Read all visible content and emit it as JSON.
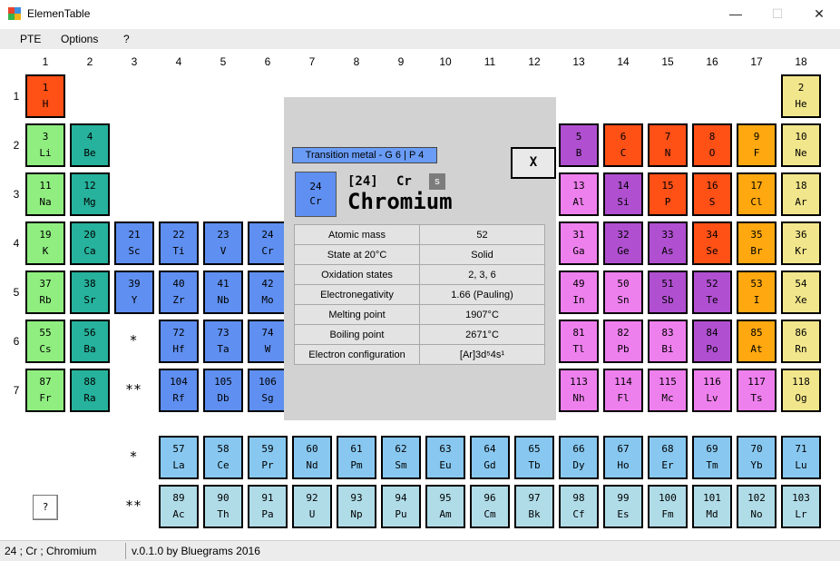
{
  "window": {
    "title": "ElemenTable",
    "minimize_icon": "minimize-icon",
    "maximize_icon": "maximize-icon",
    "close_icon": "close-icon"
  },
  "menu": [
    "PTE",
    "Options",
    "?"
  ],
  "groups": [
    "1",
    "2",
    "3",
    "4",
    "5",
    "6",
    "7",
    "8",
    "9",
    "10",
    "11",
    "12",
    "13",
    "14",
    "15",
    "16",
    "17",
    "18"
  ],
  "periods": [
    "1",
    "2",
    "3",
    "4",
    "5",
    "6",
    "7"
  ],
  "series_markers": {
    "lanthanide": "*",
    "actinide": "**"
  },
  "help_button": "?",
  "colors": {
    "alkali": "#90ee80",
    "alkaline_earth": "#26b29c",
    "transition": "#5f8ff0",
    "post_transition": "#ee80ee",
    "metalloid": "#b050d0",
    "nonmetal": "#ff5016",
    "halogen": "#ffa810",
    "noble_gas": "#f2e68c",
    "lanthanide": "#88c8f0",
    "actinide": "#b0dce8"
  },
  "elements": [
    {
      "n": "1",
      "s": "H",
      "t": "nonmetal"
    },
    {
      "n": "2",
      "s": "He",
      "t": "noble_gas"
    },
    {
      "n": "3",
      "s": "Li",
      "t": "alkali"
    },
    {
      "n": "4",
      "s": "Be",
      "t": "alkaline_earth"
    },
    {
      "n": "5",
      "s": "B",
      "t": "metalloid"
    },
    {
      "n": "6",
      "s": "C",
      "t": "nonmetal"
    },
    {
      "n": "7",
      "s": "N",
      "t": "nonmetal"
    },
    {
      "n": "8",
      "s": "O",
      "t": "nonmetal"
    },
    {
      "n": "9",
      "s": "F",
      "t": "halogen"
    },
    {
      "n": "10",
      "s": "Ne",
      "t": "noble_gas"
    },
    {
      "n": "11",
      "s": "Na",
      "t": "alkali"
    },
    {
      "n": "12",
      "s": "Mg",
      "t": "alkaline_earth"
    },
    {
      "n": "13",
      "s": "Al",
      "t": "post_transition"
    },
    {
      "n": "14",
      "s": "Si",
      "t": "metalloid"
    },
    {
      "n": "15",
      "s": "P",
      "t": "nonmetal"
    },
    {
      "n": "16",
      "s": "S",
      "t": "nonmetal"
    },
    {
      "n": "17",
      "s": "Cl",
      "t": "halogen"
    },
    {
      "n": "18",
      "s": "Ar",
      "t": "noble_gas"
    },
    {
      "n": "19",
      "s": "K",
      "t": "alkali"
    },
    {
      "n": "20",
      "s": "Ca",
      "t": "alkaline_earth"
    },
    {
      "n": "21",
      "s": "Sc",
      "t": "transition"
    },
    {
      "n": "22",
      "s": "Ti",
      "t": "transition"
    },
    {
      "n": "23",
      "s": "V",
      "t": "transition"
    },
    {
      "n": "24",
      "s": "Cr",
      "t": "transition"
    },
    {
      "n": "31",
      "s": "Ga",
      "t": "post_transition"
    },
    {
      "n": "32",
      "s": "Ge",
      "t": "metalloid"
    },
    {
      "n": "33",
      "s": "As",
      "t": "metalloid"
    },
    {
      "n": "34",
      "s": "Se",
      "t": "nonmetal"
    },
    {
      "n": "35",
      "s": "Br",
      "t": "halogen"
    },
    {
      "n": "36",
      "s": "Kr",
      "t": "noble_gas"
    },
    {
      "n": "37",
      "s": "Rb",
      "t": "alkali"
    },
    {
      "n": "38",
      "s": "Sr",
      "t": "alkaline_earth"
    },
    {
      "n": "39",
      "s": "Y",
      "t": "transition"
    },
    {
      "n": "40",
      "s": "Zr",
      "t": "transition"
    },
    {
      "n": "41",
      "s": "Nb",
      "t": "transition"
    },
    {
      "n": "42",
      "s": "Mo",
      "t": "transition"
    },
    {
      "n": "49",
      "s": "In",
      "t": "post_transition"
    },
    {
      "n": "50",
      "s": "Sn",
      "t": "post_transition"
    },
    {
      "n": "51",
      "s": "Sb",
      "t": "metalloid"
    },
    {
      "n": "52",
      "s": "Te",
      "t": "metalloid"
    },
    {
      "n": "53",
      "s": "I",
      "t": "halogen"
    },
    {
      "n": "54",
      "s": "Xe",
      "t": "noble_gas"
    },
    {
      "n": "55",
      "s": "Cs",
      "t": "alkali"
    },
    {
      "n": "56",
      "s": "Ba",
      "t": "alkaline_earth"
    },
    {
      "n": "72",
      "s": "Hf",
      "t": "transition"
    },
    {
      "n": "73",
      "s": "Ta",
      "t": "transition"
    },
    {
      "n": "74",
      "s": "W",
      "t": "transition"
    },
    {
      "n": "81",
      "s": "Tl",
      "t": "post_transition"
    },
    {
      "n": "82",
      "s": "Pb",
      "t": "post_transition"
    },
    {
      "n": "83",
      "s": "Bi",
      "t": "post_transition"
    },
    {
      "n": "84",
      "s": "Po",
      "t": "metalloid"
    },
    {
      "n": "85",
      "s": "At",
      "t": "halogen"
    },
    {
      "n": "86",
      "s": "Rn",
      "t": "noble_gas"
    },
    {
      "n": "87",
      "s": "Fr",
      "t": "alkali"
    },
    {
      "n": "88",
      "s": "Ra",
      "t": "alkaline_earth"
    },
    {
      "n": "104",
      "s": "Rf",
      "t": "transition"
    },
    {
      "n": "105",
      "s": "Db",
      "t": "transition"
    },
    {
      "n": "106",
      "s": "Sg",
      "t": "transition"
    },
    {
      "n": "113",
      "s": "Nh",
      "t": "post_transition"
    },
    {
      "n": "114",
      "s": "Fl",
      "t": "post_transition"
    },
    {
      "n": "115",
      "s": "Mc",
      "t": "post_transition"
    },
    {
      "n": "116",
      "s": "Lv",
      "t": "post_transition"
    },
    {
      "n": "117",
      "s": "Ts",
      "t": "post_transition"
    },
    {
      "n": "118",
      "s": "Og",
      "t": "noble_gas"
    },
    {
      "n": "57",
      "s": "La",
      "t": "lanthanide"
    },
    {
      "n": "58",
      "s": "Ce",
      "t": "lanthanide"
    },
    {
      "n": "59",
      "s": "Pr",
      "t": "lanthanide"
    },
    {
      "n": "60",
      "s": "Nd",
      "t": "lanthanide"
    },
    {
      "n": "61",
      "s": "Pm",
      "t": "lanthanide"
    },
    {
      "n": "62",
      "s": "Sm",
      "t": "lanthanide"
    },
    {
      "n": "63",
      "s": "Eu",
      "t": "lanthanide"
    },
    {
      "n": "64",
      "s": "Gd",
      "t": "lanthanide"
    },
    {
      "n": "65",
      "s": "Tb",
      "t": "lanthanide"
    },
    {
      "n": "66",
      "s": "Dy",
      "t": "lanthanide"
    },
    {
      "n": "67",
      "s": "Ho",
      "t": "lanthanide"
    },
    {
      "n": "68",
      "s": "Er",
      "t": "lanthanide"
    },
    {
      "n": "69",
      "s": "Tm",
      "t": "lanthanide"
    },
    {
      "n": "70",
      "s": "Yb",
      "t": "lanthanide"
    },
    {
      "n": "71",
      "s": "Lu",
      "t": "lanthanide"
    },
    {
      "n": "89",
      "s": "Ac",
      "t": "actinide"
    },
    {
      "n": "90",
      "s": "Th",
      "t": "actinide"
    },
    {
      "n": "91",
      "s": "Pa",
      "t": "actinide"
    },
    {
      "n": "92",
      "s": "U",
      "t": "actinide"
    },
    {
      "n": "93",
      "s": "Np",
      "t": "actinide"
    },
    {
      "n": "94",
      "s": "Pu",
      "t": "actinide"
    },
    {
      "n": "95",
      "s": "Am",
      "t": "actinide"
    },
    {
      "n": "96",
      "s": "Cm",
      "t": "actinide"
    },
    {
      "n": "97",
      "s": "Bk",
      "t": "actinide"
    },
    {
      "n": "98",
      "s": "Cf",
      "t": "actinide"
    },
    {
      "n": "99",
      "s": "Es",
      "t": "actinide"
    },
    {
      "n": "100",
      "s": "Fm",
      "t": "actinide"
    },
    {
      "n": "101",
      "s": "Md",
      "t": "actinide"
    },
    {
      "n": "102",
      "s": "No",
      "t": "actinide"
    },
    {
      "n": "103",
      "s": "Lr",
      "t": "actinide"
    }
  ],
  "detail": {
    "category": "Transition metal - G 6 | P 4",
    "close_label": "X",
    "tile_number": "24",
    "tile_symbol": "Cr",
    "number": "[24]",
    "symbol": "Cr",
    "block": "s",
    "name": "Chromium",
    "properties": [
      {
        "label": "Atomic mass",
        "value": "52"
      },
      {
        "label": "State at 20°C",
        "value": "Solid"
      },
      {
        "label": "Oxidation states",
        "value": "2, 3, 6"
      },
      {
        "label": "Electronegativity",
        "value": "1.66 (Pauling)"
      },
      {
        "label": "Melting point",
        "value": "1907°C"
      },
      {
        "label": "Boiling point",
        "value": "2671°C"
      },
      {
        "label": "Electron configuration",
        "value": "[Ar]3d⁵4s¹"
      }
    ]
  },
  "status": {
    "selection": "24 ; Cr ; Chromium",
    "version": "v.0.1.0 by Bluegrams 2016"
  }
}
